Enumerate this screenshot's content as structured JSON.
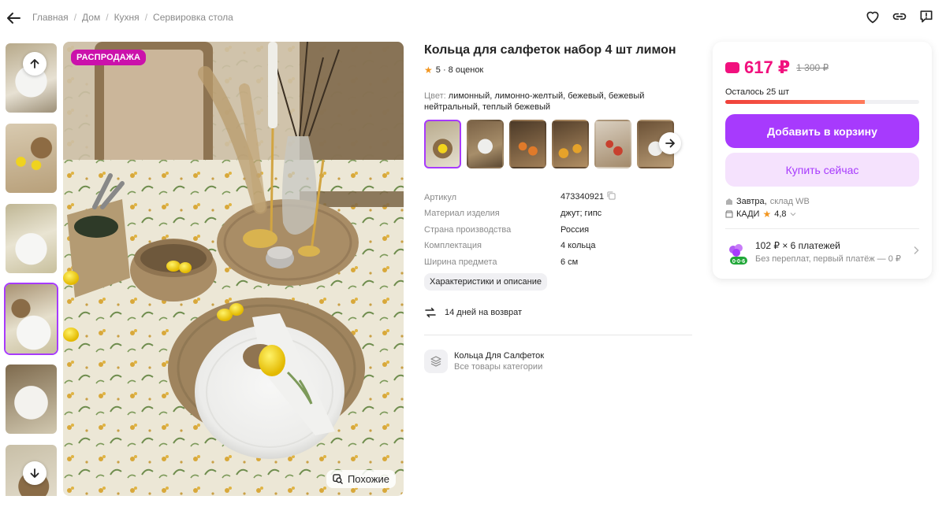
{
  "breadcrumb": [
    "Главная",
    "Дом",
    "Кухня",
    "Сервировка стола"
  ],
  "gallery": {
    "sale_badge": "РАСПРОДАЖА",
    "similar_label": "Похожие"
  },
  "product": {
    "title": "Кольца для салфеток набор 4 шт лимон",
    "rating_text": "5 · 8 оценок",
    "color_label": "Цвет:",
    "color_value": "лимонный, лимонно-желтый, бежевый, бежевый нейтральный, теплый бежевый"
  },
  "specs": [
    {
      "key": "Артикул",
      "value": "473340921"
    },
    {
      "key": "Материал изделия",
      "value": "джут; гипс"
    },
    {
      "key": "Страна производства",
      "value": "Россия"
    },
    {
      "key": "Комплектация",
      "value": "4 кольца"
    },
    {
      "key": "Ширина предмета",
      "value": "6 см"
    }
  ],
  "details_chip": "Характеристики и описание",
  "return_text": "14 дней на возврат",
  "category": {
    "name": "Кольца Для Салфеток",
    "sub": "Все товары категории"
  },
  "buy": {
    "price": "617 ₽",
    "old_price": "1 300 ₽",
    "stock_text": "Осталось 25 шт",
    "stock_fraction": 0.72,
    "add_to_cart": "Добавить в корзину",
    "buy_now": "Купить сейчас",
    "delivery_day": "Завтра,",
    "delivery_wh": "склад WB",
    "seller": "КАДИ",
    "seller_rating": "4,8",
    "installment_main": "102 ₽ × 6 платежей",
    "installment_sub": "Без переплат, первый платёж — 0 ₽",
    "installment_badge": "0·0·6"
  },
  "colors": {
    "accent": "#a73afd",
    "price": "#f1117e",
    "sale": "#cb11ab"
  }
}
